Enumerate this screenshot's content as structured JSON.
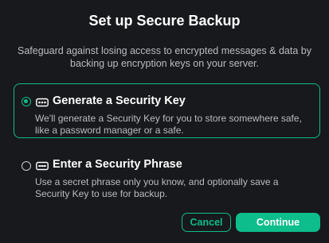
{
  "dialog": {
    "title": "Set up Secure Backup",
    "description": "Safeguard against losing access to encrypted messages & data by backing up encryption keys on your server."
  },
  "options": [
    {
      "title": "Generate a Security Key",
      "description": "We'll generate a Security Key for you to store somewhere safe, like a password manager or a safe.",
      "icon": "key-icon",
      "selected": true
    },
    {
      "title": "Enter a Security Phrase",
      "description": "Use a secret phrase only you know, and optionally save a Security Key to use for backup.",
      "icon": "lock-icon",
      "selected": false
    }
  ],
  "buttons": {
    "cancel_label": "Cancel",
    "continue_label": "Continue"
  },
  "colors": {
    "accent": "#0dbd8b",
    "background": "#18191c",
    "text_secondary": "#b8bcc2"
  }
}
